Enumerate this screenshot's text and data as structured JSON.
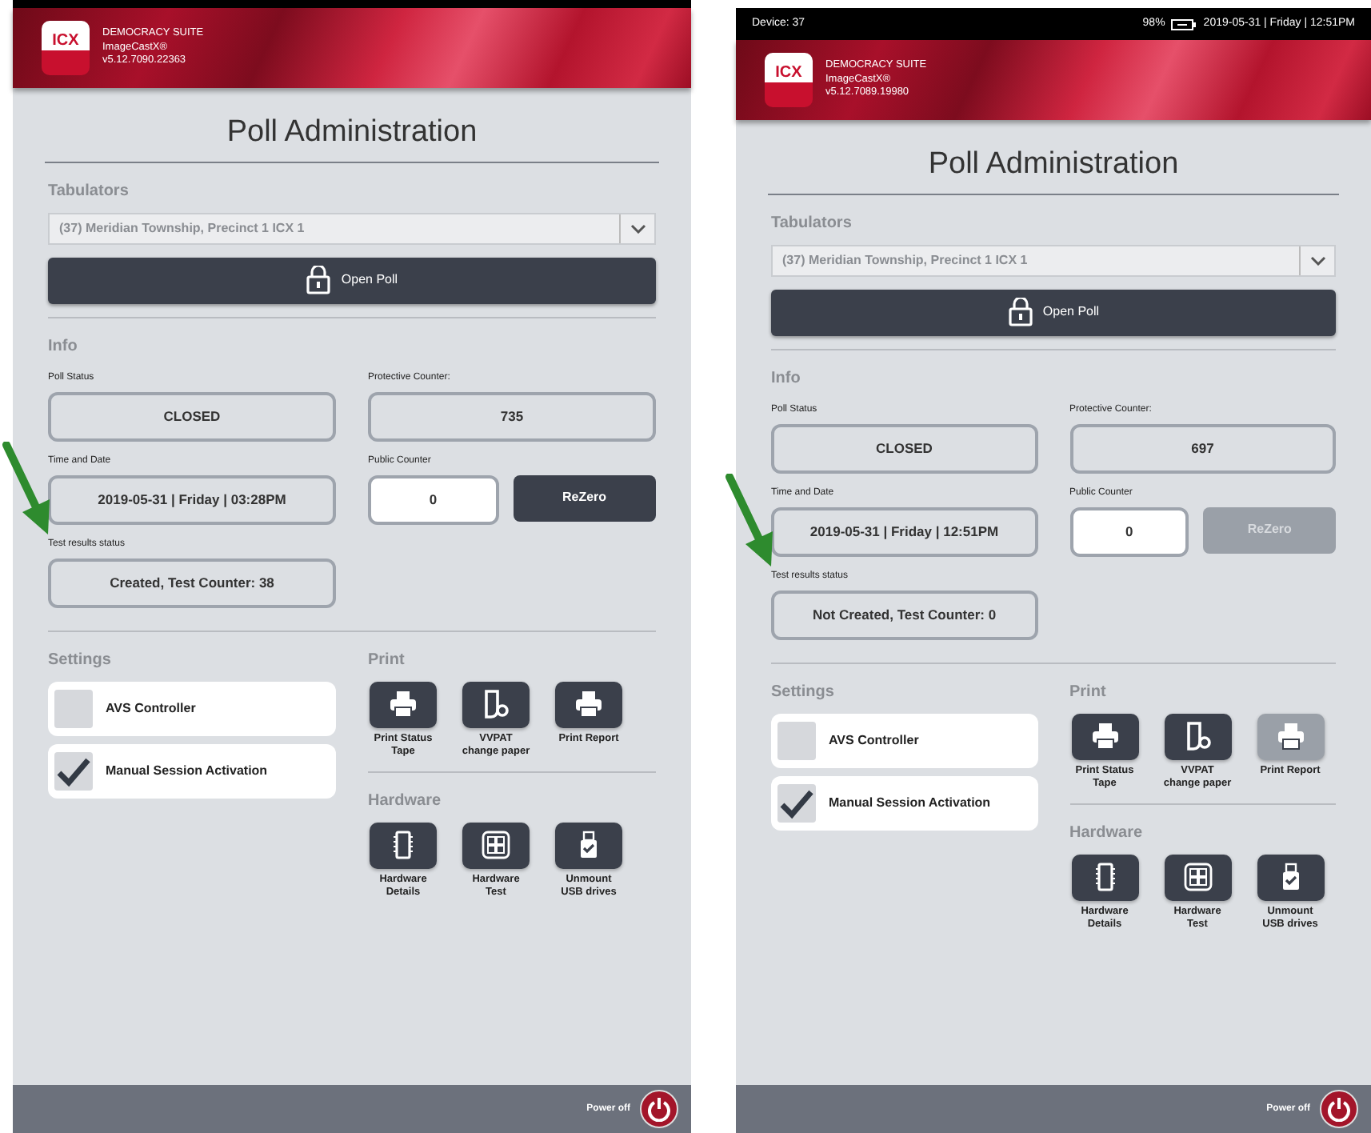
{
  "screens": [
    {
      "header": {
        "logo": "ICX",
        "suite": "DEMOCRACY SUITE",
        "product": "ImageCastX®",
        "version": "v5.12.7090.22363"
      },
      "title": "Poll Administration",
      "tabulators": {
        "label": "Tabulators",
        "value": "(37) Meridian Township, Precinct 1 ICX 1",
        "open_button": "Open Poll"
      },
      "info": {
        "label": "Info",
        "fields": [
          {
            "label": "Poll Status",
            "value": "CLOSED"
          },
          {
            "label": "Protective Counter:",
            "value": "735"
          },
          {
            "label": "Time and Date",
            "value": "2019-05-31 | Friday | 03:28PM"
          },
          {
            "label": "Public Counter",
            "value": "0",
            "kind": "counter",
            "button": "ReZero",
            "disabled": false
          },
          {
            "label": "Test results status",
            "value": "Created, Test Counter: 38",
            "pointer_arrow": true
          }
        ]
      },
      "settings": {
        "label": "Settings",
        "items": [
          {
            "label": "AVS Controller",
            "checked": false
          },
          {
            "label": "Manual Session Activation",
            "checked": true
          }
        ]
      },
      "print": {
        "label": "Print",
        "actions": [
          {
            "label": "Print Status Tape",
            "kind": "printer",
            "disabled": false
          },
          {
            "label": "VVPAT change paper",
            "kind": "paper",
            "disabled": false
          },
          {
            "label": "Print Report",
            "kind": "printer",
            "disabled": false
          }
        ]
      },
      "hardware": {
        "label": "Hardware",
        "actions": [
          {
            "label": "Hardware Details",
            "kind": "chip",
            "disabled": false
          },
          {
            "label": "Hardware Test",
            "kind": "grid",
            "disabled": false
          },
          {
            "label": "Unmount USB drives",
            "kind": "usb",
            "disabled": false
          }
        ]
      },
      "footer": {
        "power_label": "Power off"
      }
    },
    {
      "status_bar": {
        "device": "Device: 37",
        "battery": "98%",
        "datetime": "2019-05-31 | Friday | 12:51PM"
      },
      "header": {
        "logo": "ICX",
        "suite": "DEMOCRACY SUITE",
        "product": "ImageCastX®",
        "version": "v5.12.7089.19980"
      },
      "title": "Poll Administration",
      "tabulators": {
        "label": "Tabulators",
        "value": "(37) Meridian Township, Precinct 1 ICX 1",
        "open_button": "Open Poll"
      },
      "info": {
        "label": "Info",
        "fields": [
          {
            "label": "Poll Status",
            "value": "CLOSED"
          },
          {
            "label": "Protective Counter:",
            "value": "697"
          },
          {
            "label": "Time and Date",
            "value": "2019-05-31 | Friday | 12:51PM"
          },
          {
            "label": "Public Counter",
            "value": "0",
            "kind": "counter",
            "button": "ReZero",
            "disabled": true
          },
          {
            "label": "Test results status",
            "value": "Not Created, Test Counter: 0",
            "pointer_arrow": true
          }
        ]
      },
      "settings": {
        "label": "Settings",
        "items": [
          {
            "label": "AVS Controller",
            "checked": false
          },
          {
            "label": "Manual Session Activation",
            "checked": true
          }
        ]
      },
      "print": {
        "label": "Print",
        "actions": [
          {
            "label": "Print Status Tape",
            "kind": "printer",
            "disabled": false
          },
          {
            "label": "VVPAT change paper",
            "kind": "paper",
            "disabled": false
          },
          {
            "label": "Print Report",
            "kind": "printer",
            "disabled": true
          }
        ]
      },
      "hardware": {
        "label": "Hardware",
        "actions": [
          {
            "label": "Hardware Details",
            "kind": "chip",
            "disabled": false
          },
          {
            "label": "Hardware Test",
            "kind": "grid",
            "disabled": false
          },
          {
            "label": "Unmount USB drives",
            "kind": "usb",
            "disabled": false
          }
        ]
      },
      "footer": {
        "power_label": "Power off"
      }
    }
  ]
}
